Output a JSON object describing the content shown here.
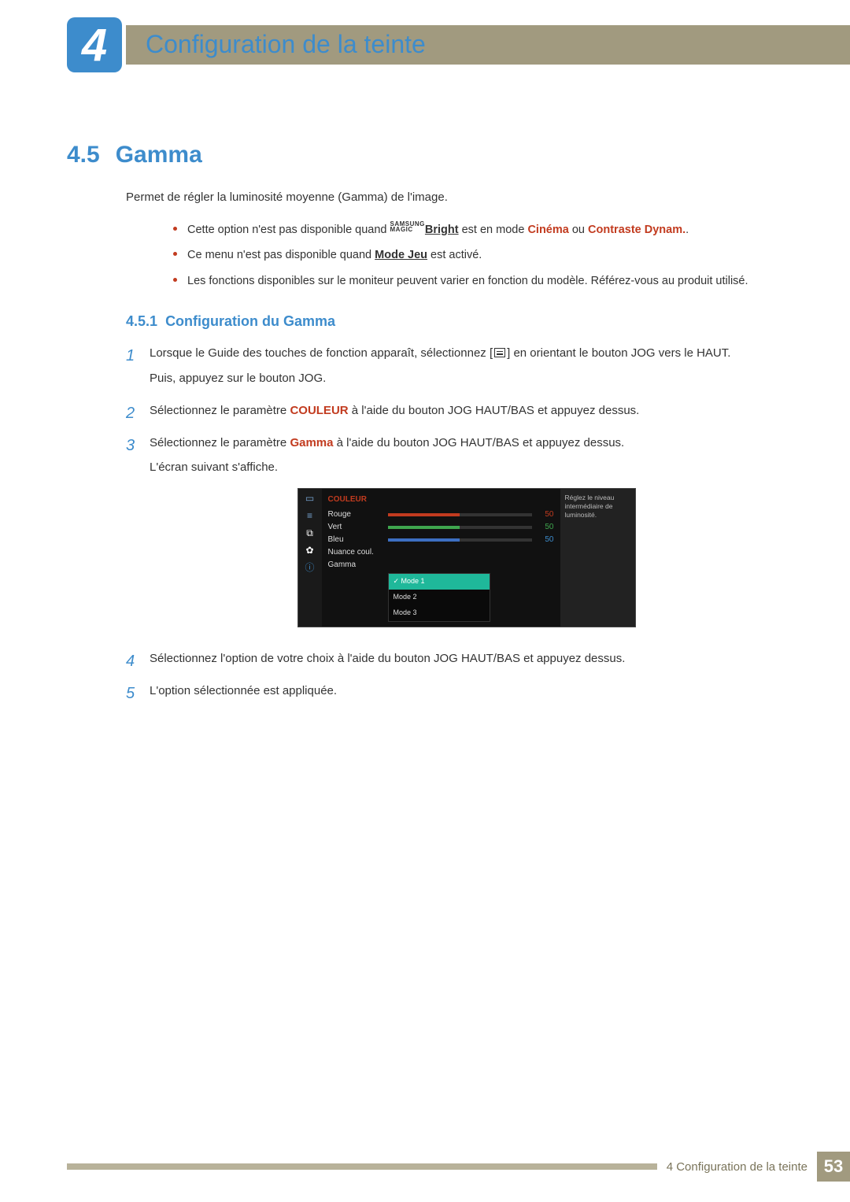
{
  "header": {
    "chapter_number": "4",
    "chapter_title": "Configuration de la teinte"
  },
  "section": {
    "number": "4.5",
    "title": "Gamma",
    "intro": "Permet de régler la luminosité moyenne (Gamma) de l'image."
  },
  "bullets": {
    "b1_pre": "Cette option n'est pas disponible quand ",
    "b1_magic_top": "SAMSUNG",
    "b1_magic_bottom": "MAGIC",
    "b1_magic_word": "Bright",
    "b1_mid": " est en mode ",
    "b1_cinema": "Cinéma",
    "b1_or": " ou ",
    "b1_contrast": "Contraste Dynam.",
    "b1_end": ".",
    "b2_pre": "Ce menu n'est pas disponible quand ",
    "b2_mode": "Mode Jeu",
    "b2_post": " est activé.",
    "b3": "Les fonctions disponibles sur le moniteur peuvent varier en fonction du modèle. Référez-vous au produit utilisé."
  },
  "subsection": {
    "number": "4.5.1",
    "title": "Configuration du Gamma"
  },
  "steps": {
    "s1_a": "Lorsque le Guide des touches de fonction apparaît, sélectionnez [",
    "s1_b": "] en orientant le bouton JOG vers le HAUT.",
    "s1_c": "Puis, appuyez sur le bouton JOG.",
    "s2_pre": "Sélectionnez le paramètre ",
    "s2_word": "COULEUR",
    "s2_post": " à l'aide du bouton JOG HAUT/BAS et appuyez dessus.",
    "s3_pre": "Sélectionnez le paramètre ",
    "s3_word": "Gamma",
    "s3_post": " à l'aide du bouton JOG HAUT/BAS et appuyez dessus.",
    "s3_extra": "L'écran suivant s'affiche.",
    "s4": "Sélectionnez l'option de votre choix à l'aide du bouton JOG HAUT/BAS et appuyez dessus.",
    "s5": "L'option sélectionnée est appliquée."
  },
  "osd": {
    "title": "COULEUR",
    "rows": {
      "rouge": {
        "label": "Rouge",
        "value": "50"
      },
      "vert": {
        "label": "Vert",
        "value": "50"
      },
      "bleu": {
        "label": "Bleu",
        "value": "50"
      },
      "nuance": {
        "label": "Nuance coul."
      },
      "gamma": {
        "label": "Gamma"
      }
    },
    "options": {
      "mode1": "Mode 1",
      "mode2": "Mode 2",
      "mode3": "Mode 3"
    },
    "info": "Réglez le niveau intermédiaire de luminosité."
  },
  "footer": {
    "text": "4 Configuration de la teinte",
    "page": "53"
  }
}
